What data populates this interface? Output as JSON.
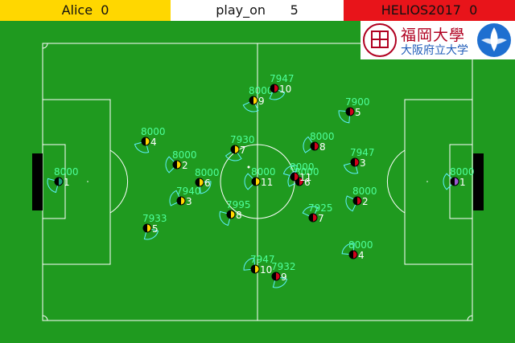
{
  "scoreboard": {
    "left_team": "Alice",
    "left_score": "0",
    "play_mode": "play_on",
    "cycle": "5",
    "right_team": "HELIOS2017",
    "right_score": "0",
    "left_color": "#ffd700",
    "right_color": "#e8141a"
  },
  "logo": {
    "text_cn": "福岡大學",
    "text_jp": "大阪府立大学",
    "icon": "university-emblem"
  },
  "left_players": [
    {
      "num": "1",
      "stamina": "8000",
      "x": 0,
      "y": 0,
      "kind": "goalie"
    },
    {
      "num": "2",
      "stamina": "8000",
      "x": 0,
      "y": 0
    },
    {
      "num": "3",
      "stamina": "7940",
      "x": 0,
      "y": 0
    },
    {
      "num": "4",
      "stamina": "8000",
      "x": 0,
      "y": 0
    },
    {
      "num": "5",
      "stamina": "7933",
      "x": 0,
      "y": 0
    },
    {
      "num": "6",
      "stamina": "8000",
      "x": 0,
      "y": 0
    },
    {
      "num": "7",
      "stamina": "7930",
      "x": 0,
      "y": 0
    },
    {
      "num": "8",
      "stamina": "7995",
      "x": 0,
      "y": 0
    },
    {
      "num": "9",
      "stamina": "8000",
      "x": 0,
      "y": 0
    },
    {
      "num": "10",
      "stamina": "7947",
      "x": 0,
      "y": 0
    },
    {
      "num": "11",
      "stamina": "8000",
      "x": 0,
      "y": 0
    }
  ],
  "right_players": [
    {
      "num": "1",
      "stamina": "8000",
      "kind": "goalie"
    },
    {
      "num": "2",
      "stamina": "8000"
    },
    {
      "num": "3",
      "stamina": "7947"
    },
    {
      "num": "4",
      "stamina": "8000"
    },
    {
      "num": "5",
      "stamina": "7900"
    },
    {
      "num": "6",
      "stamina": "8000"
    },
    {
      "num": "7",
      "stamina": "7925"
    },
    {
      "num": "8",
      "stamina": "8000"
    },
    {
      "num": "9",
      "stamina": "7932"
    },
    {
      "num": "10",
      "stamina": "7947"
    },
    {
      "num": "11",
      "stamina": "8000"
    }
  ],
  "colors": {
    "pitch": "#1f9a1f",
    "lines": "#ffffff",
    "stamina_text": "#4dff9a",
    "view_cone": "#5ff0ff",
    "left_body": "#ffd700",
    "right_body": "#d0021b",
    "goalie_left": "#1aa37a",
    "goalie_right": "#9b59d0"
  }
}
